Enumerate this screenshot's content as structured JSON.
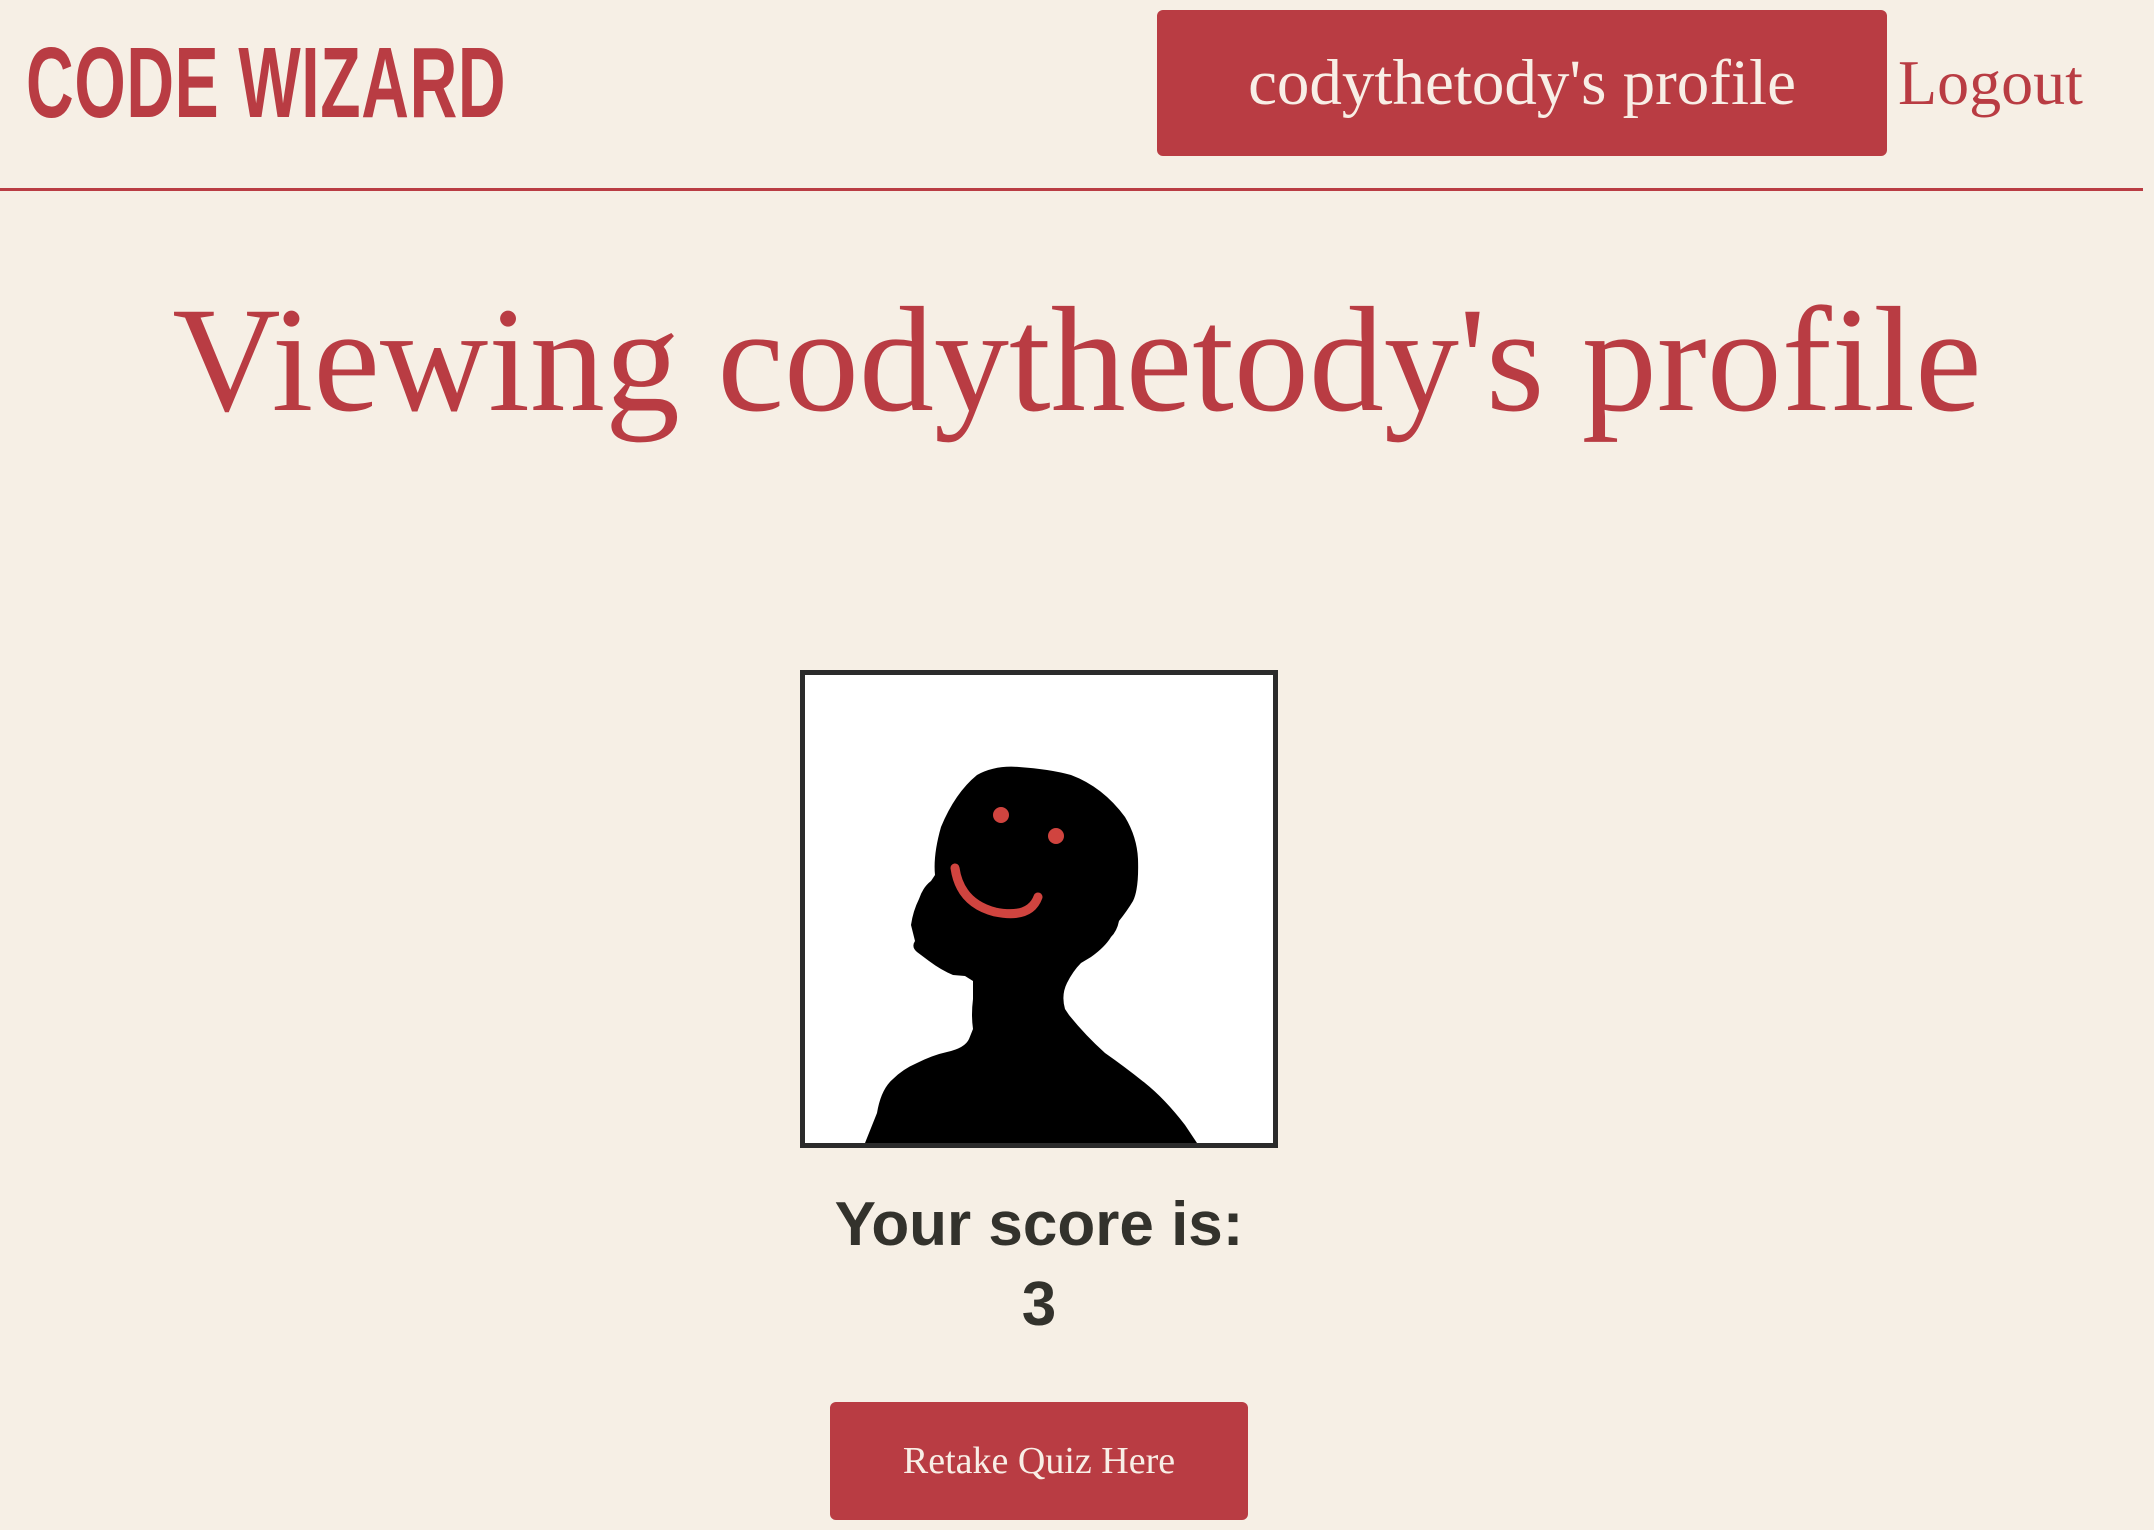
{
  "header": {
    "logo_text": "CODE WIZARD",
    "profile_button_label": "codythetody's profile",
    "logout_label": "Logout"
  },
  "main": {
    "title": "Viewing codythetody's profile",
    "avatar_icon": "person-silhouette-icon",
    "score_label": "Your score is:",
    "score_value": "3",
    "retake_button_label": "Retake Quiz Here"
  },
  "colors": {
    "background": "#f6efe5",
    "accent": "#b93c43",
    "button_text": "#f8eee6",
    "text_dark": "#33322c",
    "frame_border": "#2b2b2b"
  }
}
